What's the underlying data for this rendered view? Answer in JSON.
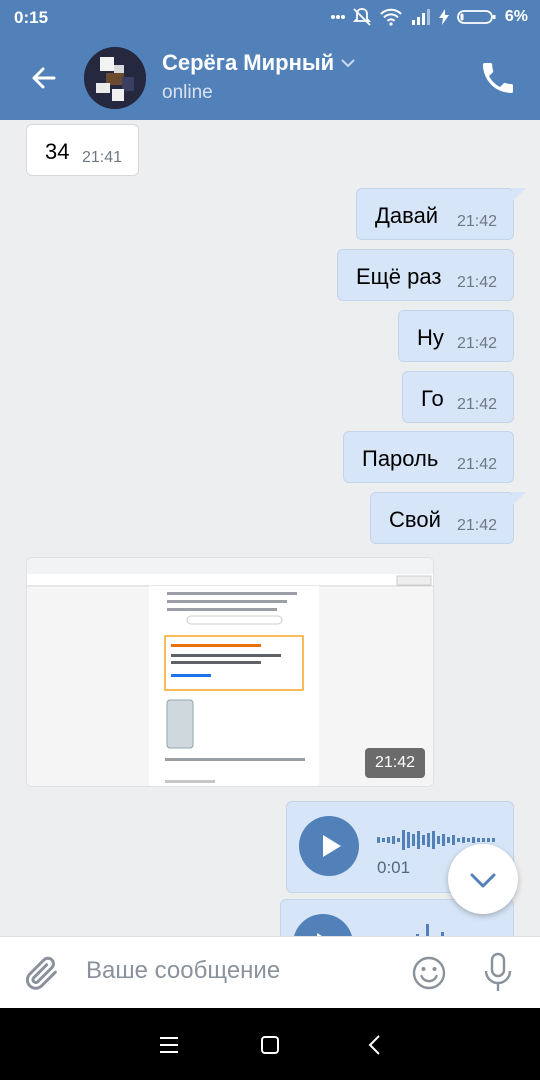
{
  "status_bar": {
    "time": "0:15",
    "battery": "6%"
  },
  "header": {
    "name": "Серёга Мирный",
    "status": "online"
  },
  "messages": [
    {
      "text": "34",
      "time": "21:41",
      "dir": "in"
    },
    {
      "text": "Давай",
      "time": "21:42",
      "dir": "out"
    },
    {
      "text": "Ещё раз",
      "time": "21:42",
      "dir": "out"
    },
    {
      "text": "Ну",
      "time": "21:42",
      "dir": "out"
    },
    {
      "text": "Го",
      "time": "21:42",
      "dir": "out"
    },
    {
      "text": "Пароль",
      "time": "21:42",
      "dir": "out"
    },
    {
      "text": "Свой",
      "time": "21:42",
      "dir": "out"
    }
  ],
  "photo": {
    "time": "21:42"
  },
  "voice": {
    "duration": "0:01"
  },
  "composer": {
    "placeholder": "Ваше сообщение"
  },
  "icons": {
    "back": "arrow-left-icon",
    "call": "phone-icon",
    "attach": "paperclip-icon",
    "emoji": "smiley-icon",
    "mic": "microphone-icon",
    "scroll_down": "chevron-down-icon",
    "play": "play-icon",
    "menu": "menu-icon",
    "home": "home-icon",
    "nav_back": "chevron-left-icon"
  },
  "colors": {
    "accent": "#5181b8",
    "outgoing_bubble": "#d6e5f7",
    "chat_bg": "#edeef0"
  }
}
